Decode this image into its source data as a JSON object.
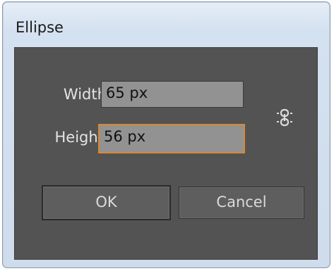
{
  "window": {
    "title": "Ellipse"
  },
  "form": {
    "width_label": "Width:",
    "width_value": "65 px",
    "height_label": "Height:",
    "height_value": "56 px",
    "constrain_icon": "link-chain-icon"
  },
  "buttons": {
    "ok_label": "OK",
    "cancel_label": "Cancel"
  },
  "colors": {
    "panel": "#535353",
    "focus_border": "#d9892f",
    "field_bg": "#929292"
  }
}
